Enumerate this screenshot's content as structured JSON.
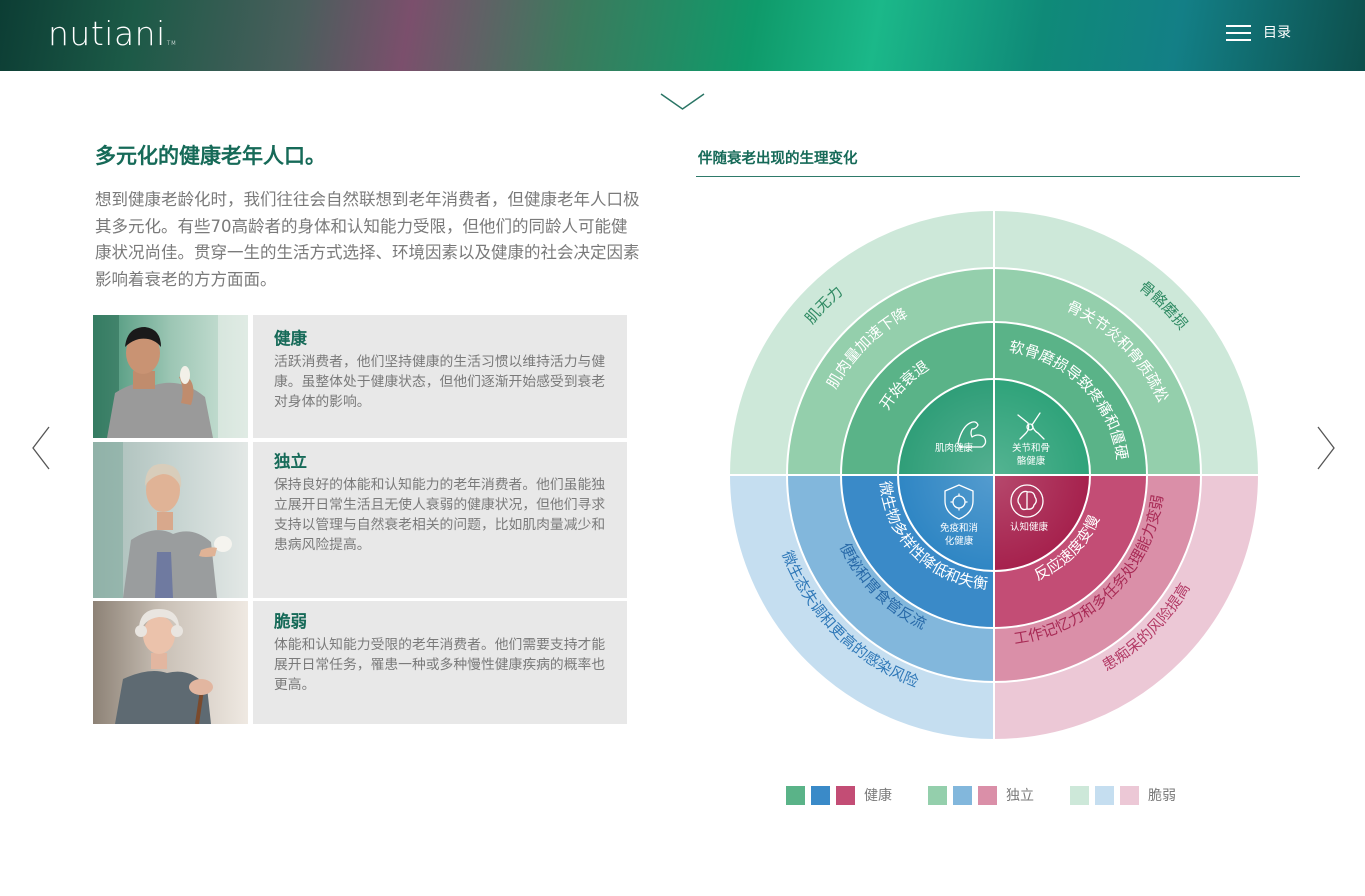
{
  "header": {
    "logo_text": "nutiani",
    "logo_tm": "TM",
    "menu_label": "目录"
  },
  "intro": {
    "title": "多元化的健康老年人口。",
    "paragraph": "想到健康老龄化时，我们往往会自然联想到老年消费者，但健康老年人口极其多元化。有些70高龄者的身体和认知能力受限，但他们的同龄人可能健康状况尚佳。贯穿一生的生活方式选择、环境因素以及健康的社会决定因素影响着衰老的方方面面。"
  },
  "cards": [
    {
      "title": "健康",
      "body": "活跃消费者，他们坚持健康的生活习惯以维持活力与健康。虽整体处于健康状态，但他们逐渐开始感受到衰老对身体的影响。"
    },
    {
      "title": "独立",
      "body": "保持良好的体能和认知能力的老年消费者。他们虽能独立展开日常生活且无使人衰弱的健康状况，但他们寻求支持以管理与自然衰老相关的问题，比如肌肉量减少和患病风险提高。"
    },
    {
      "title": "脆弱",
      "body": "体能和认知能力受限的老年消费者。他们需要支持才能展开日常任务，罹患一种或多种慢性健康疾病的概率也更高。"
    }
  ],
  "chart": {
    "title": "伴随衰老出现的生理变化",
    "center": {
      "muscle": [
        "肌肉健康"
      ],
      "joint": [
        "关节和骨",
        "骼健康"
      ],
      "immune": [
        "免疫和消",
        "化健康"
      ],
      "cognitive": [
        "认知健康"
      ]
    },
    "healthy": {
      "muscle": "开始衰退",
      "joint": "软骨磨损导致疼痛和僵硬",
      "immune": "微生物多样性降低和失衡",
      "cognitive": "反应速度变慢"
    },
    "independent": {
      "muscle": "肌肉量加速下降",
      "joint": "骨关节炎和骨质疏松",
      "immune": "便秘和胃食管反流",
      "cognitive": "工作记忆力和多任务处理能力变弱"
    },
    "frail": {
      "muscle": "肌无力",
      "joint": "骨骼磨损",
      "immune": "微生态失调和更高的感染风险",
      "cognitive": "患痴呆的风险提高"
    },
    "colors": {
      "healthy_green": "#5ab388",
      "healthy_blue": "#3a8ac8",
      "healthy_pink": "#c34d75",
      "independent_green": "#94cfac",
      "independent_blue": "#82b7dc",
      "independent_pink": "#da8fa8",
      "frail_green": "#cde8d9",
      "frail_blue": "#c5def0",
      "frail_pink": "#ecc8d6"
    }
  },
  "legend": {
    "healthy_label": "健康",
    "independent_label": "独立",
    "frail_label": "脆弱"
  }
}
